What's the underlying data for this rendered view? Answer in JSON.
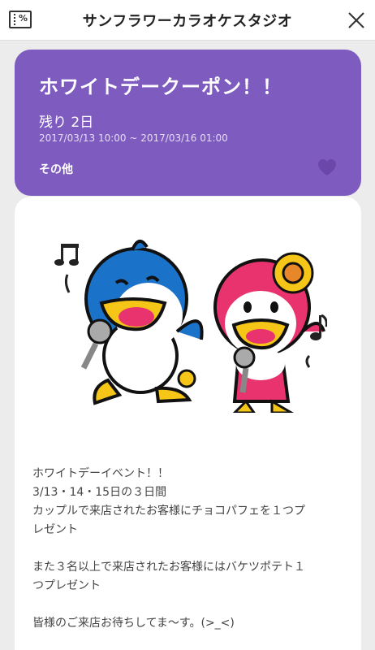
{
  "header": {
    "title": "サンフラワーカラオケスタジオ",
    "coupon_icon_text": "%",
    "coupon_icon": "coupon-ticket-icon",
    "close_icon": "close-icon"
  },
  "coupon": {
    "title": "ホワイトデークーポン！！",
    "remaining": "残り 2日",
    "period": "2017/03/13 10:00 ~ 2017/03/16 01:00",
    "category": "その他",
    "favorite_icon": "heart-icon",
    "card_color": "#7e5bbf"
  },
  "description": {
    "paragraphs": [
      [
        "ホワイトデーイベント！！",
        "3/13・14・15日の３日間",
        "カップルで来店されたお客様にチョコパフェを１つプ",
        "レゼント"
      ],
      [
        "また３名以上で来店されたお客様にはバケツポテト１",
        "つプレゼント"
      ],
      [
        "皆様のご来店お待ちしてま〜す。(>_<)"
      ]
    ]
  },
  "illustration": {
    "subject": "penguin-mascots-singing-karaoke-illustration",
    "colors": {
      "blue": "#1a73c9",
      "pink": "#e8336f",
      "yellow": "#f5c518"
    }
  }
}
